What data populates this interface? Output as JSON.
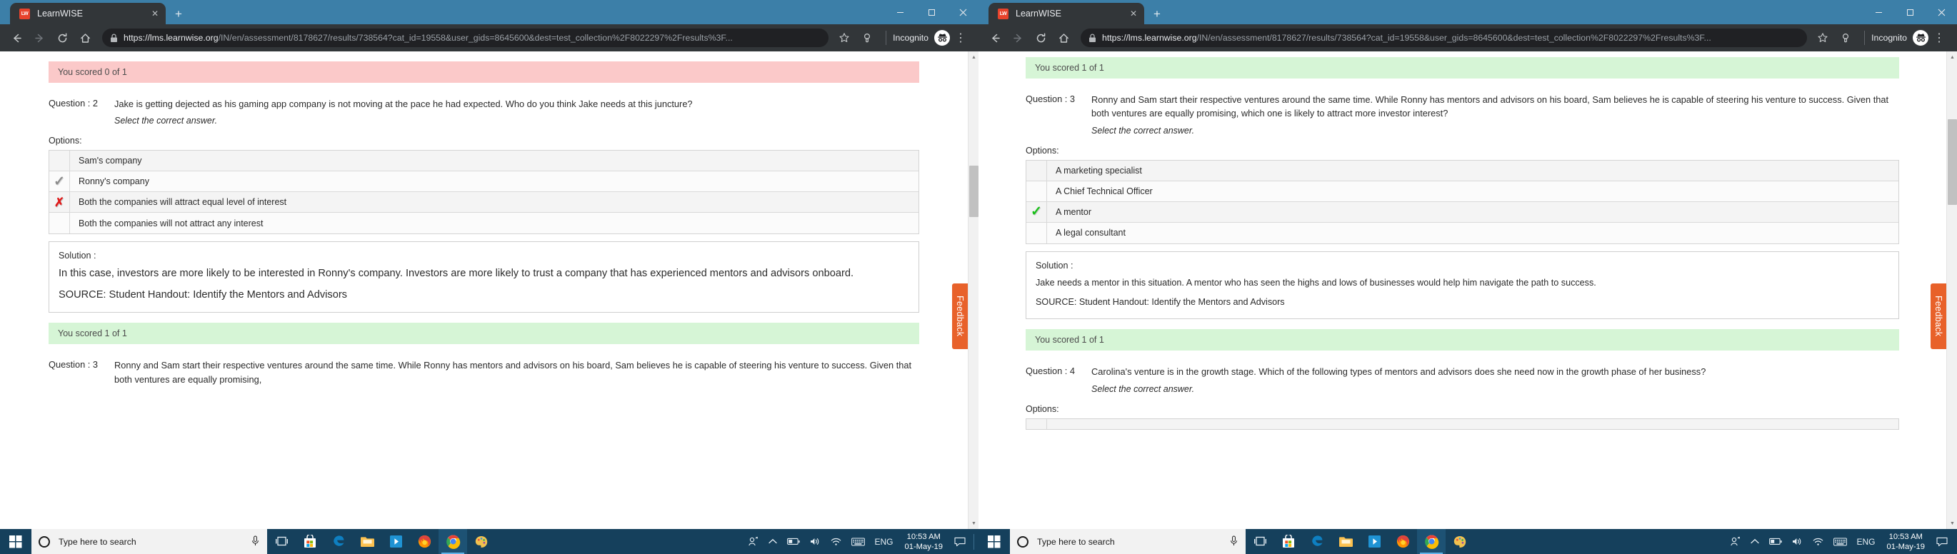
{
  "browser": {
    "tab_title": "LearnWISE",
    "tab_favicon_text": "LW",
    "tab_close_glyph": "✕",
    "newtab_glyph": "+",
    "back_glyph": "←",
    "forward_glyph": "→",
    "reload_glyph": "↻",
    "home_glyph": "⌂",
    "star_glyph": "☆",
    "url_display": "https://lms.learnwise.org/IN/en/assessment/8178627/results/738564?cat_id=19558&user_gids=8645600&dest=test_collection%2F8022297%2Fresults%3F...",
    "url_host": "https://lms.learnwise.org",
    "url_path": "/IN/en/assessment/8178627/results/738564?cat_id=19558&user_gids=8645600&dest=test_collection%2F8022297%2Fresults%3F...",
    "incognito_label": "Incognito",
    "menu_glyph": "⋮",
    "minimize_glyph": "—",
    "maximize_glyph": "❐",
    "close_glyph": "✕"
  },
  "feedback": {
    "label": "Feedback",
    "color": "#e8612a"
  },
  "left_window": {
    "banner_q2": "You scored 0 of 1",
    "q2": {
      "label": "Question : 2",
      "text": "Jake is getting dejected as his gaming app company is not moving at the pace he had expected. Who do you think Jake needs at this juncture?",
      "hint": "Select the correct answer.",
      "options_label": "Options:",
      "options": [
        {
          "mark": "none",
          "text": "Sam's company"
        },
        {
          "mark": "tick-grey",
          "text": "Ronny's company"
        },
        {
          "mark": "cross",
          "text": "Both the companies will attract equal level of interest"
        },
        {
          "mark": "none",
          "text": "Both the companies will not attract any interest"
        }
      ],
      "solution_title": "Solution :",
      "solution_body": "In this case, investors are more likely to be interested in Ronny's company. Investors are more likely to trust a company that has experienced mentors and advisors onboard.",
      "solution_source": "SOURCE: Student Handout: Identify the Mentors and Advisors"
    },
    "banner_q3": "You scored 1 of 1",
    "q3": {
      "label": "Question : 3",
      "text": "Ronny and Sam start their respective ventures around the same time. While Ronny has mentors and advisors on his board, Sam believes he is capable of steering his venture to success. Given that both ventures are equally promising,"
    }
  },
  "right_window": {
    "banner_q3": "You scored 1 of 1",
    "q3": {
      "label": "Question : 3",
      "text": "Ronny and Sam start their respective ventures around the same time. While Ronny has mentors and advisors on his board, Sam believes he is capable of steering his venture to success. Given that both ventures are equally promising, which one is likely to attract more investor interest?",
      "hint": "Select the correct answer.",
      "options_label": "Options:",
      "options": [
        {
          "mark": "none",
          "text": "A marketing specialist"
        },
        {
          "mark": "none",
          "text": "A Chief Technical Officer"
        },
        {
          "mark": "tick-green",
          "text": "A mentor"
        },
        {
          "mark": "none",
          "text": "A legal consultant"
        }
      ],
      "solution_title": "Solution :",
      "solution_body": "Jake needs a mentor in this situation. A mentor who has seen the highs and lows of businesses would help him navigate the path to success.",
      "solution_source": "SOURCE: Student Handout: Identify the Mentors and Advisors"
    },
    "banner_q4": "You scored 1 of 1",
    "q4": {
      "label": "Question : 4",
      "text": "Carolina's venture is in the growth stage. Which of the following types of mentors and advisors does she need now in the growth phase of her business?",
      "hint": "Select the correct answer.",
      "options_label": "Options:"
    }
  },
  "taskbar": {
    "search_placeholder": "Type here to search",
    "language": "ENG",
    "time": "10:53 AM",
    "date": "01-May-19",
    "apps": [
      "task-view",
      "microsoft-store",
      "edge",
      "file-explorer",
      "media-player",
      "firefox",
      "chrome",
      "paint"
    ]
  }
}
